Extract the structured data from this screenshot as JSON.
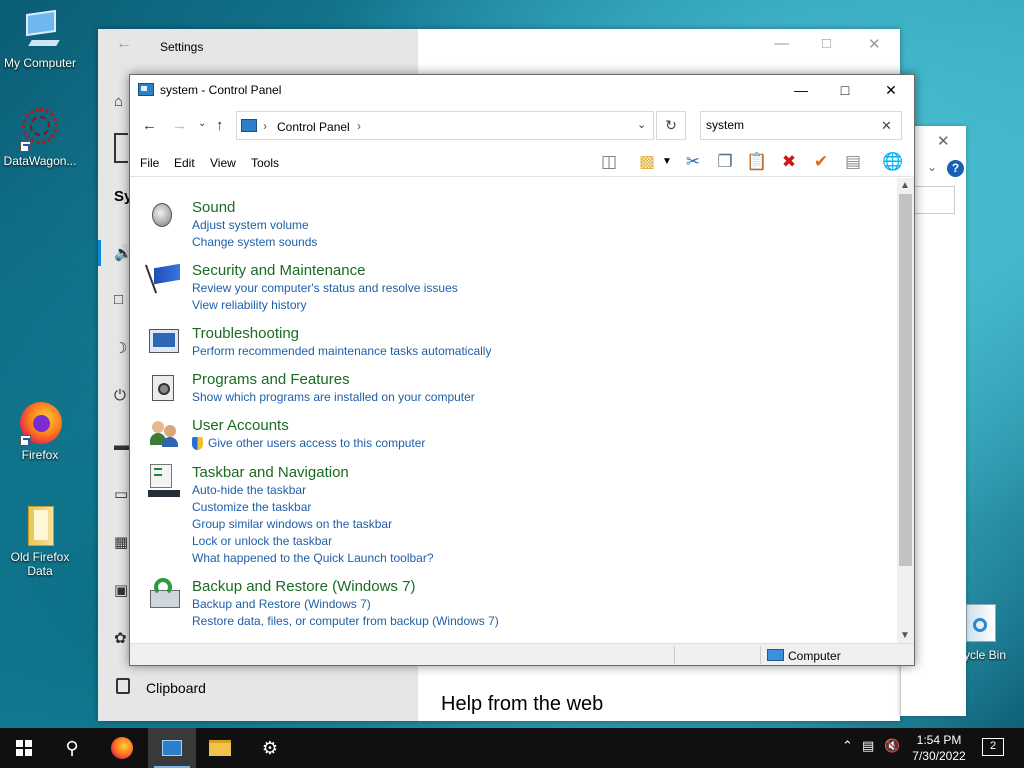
{
  "desktop": {
    "icons": [
      {
        "label": "My Computer",
        "icon": "computer-icon"
      },
      {
        "label": "DataWagon...",
        "icon": "datawagon-icon"
      },
      {
        "label": "Firefox",
        "icon": "firefox-icon"
      },
      {
        "label": "Old Firefox Data",
        "icon": "folder-icon"
      },
      {
        "label": "ycle Bin",
        "icon": "recycle-bin-icon"
      }
    ]
  },
  "settings": {
    "title": "Settings",
    "section_partial": "Sy",
    "clipboard": "Clipboard",
    "help": "Help from the web"
  },
  "control_panel": {
    "title": "system - Control Panel",
    "breadcrumb": "Control Panel",
    "search_value": "system",
    "menu": [
      "File",
      "Edit",
      "View",
      "Tools"
    ],
    "status_text": "Computer",
    "categories": [
      {
        "title": "Sound",
        "icon": "speaker-icon",
        "links": [
          "Adjust system volume",
          "Change system sounds"
        ]
      },
      {
        "title": "Security and Maintenance",
        "icon": "flag-icon",
        "links": [
          "Review your computer's status and resolve issues",
          "View reliability history"
        ]
      },
      {
        "title": "Troubleshooting",
        "icon": "troubleshoot-icon",
        "links": [
          "Perform recommended maintenance tasks automatically"
        ]
      },
      {
        "title": "Programs and Features",
        "icon": "programs-icon",
        "links": [
          "Show which programs are installed on your computer"
        ]
      },
      {
        "title": "User Accounts",
        "icon": "users-icon",
        "links": [
          "Give other users access to this computer"
        ]
      },
      {
        "title": "Taskbar and Navigation",
        "icon": "taskbar-icon",
        "links": [
          "Auto-hide the taskbar",
          "Customize the taskbar",
          "Group similar windows on the taskbar",
          "Lock or unlock the taskbar",
          "What happened to the Quick Launch toolbar?"
        ]
      },
      {
        "title": "Backup and Restore (Windows 7)",
        "icon": "backup-icon",
        "links": [
          "Backup and Restore (Windows 7)",
          "Restore data, files, or computer from backup (Windows 7)"
        ]
      }
    ]
  },
  "taskbar": {
    "time": "1:54 PM",
    "date": "7/30/2022",
    "notifications": "2"
  },
  "colors": {
    "category_title": "#1a6b22",
    "link": "#1f5fa8"
  }
}
